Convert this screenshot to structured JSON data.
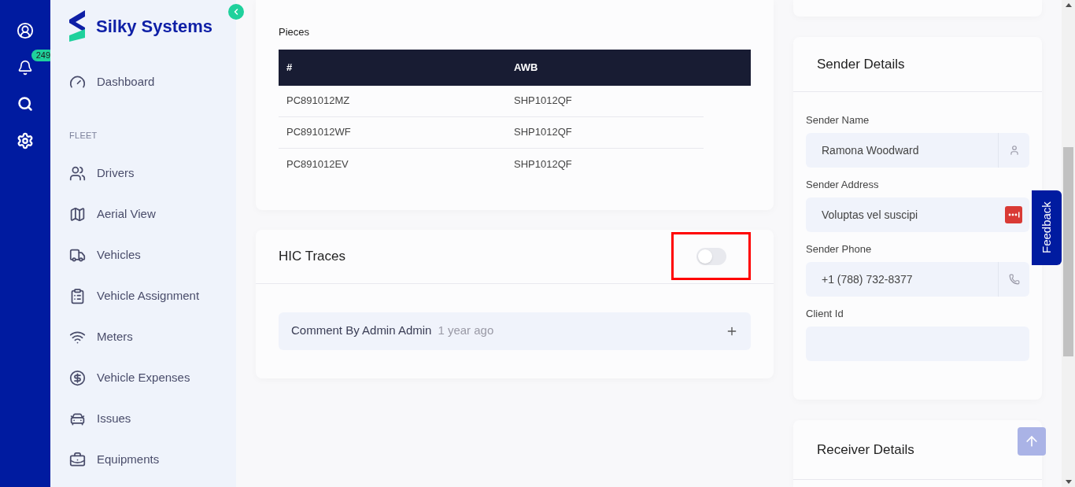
{
  "rail": {
    "notification_count": "249"
  },
  "brand": {
    "name": "Silky Systems"
  },
  "sidebar": {
    "items": [
      {
        "kind": "link",
        "label": "Dashboard"
      },
      {
        "kind": "section",
        "label": "FLEET"
      },
      {
        "kind": "link",
        "label": "Drivers"
      },
      {
        "kind": "link",
        "label": "Aerial View"
      },
      {
        "kind": "link",
        "label": "Vehicles"
      },
      {
        "kind": "link",
        "label": "Vehicle Assignment"
      },
      {
        "kind": "link",
        "label": "Meters"
      },
      {
        "kind": "link",
        "label": "Vehicle Expenses"
      },
      {
        "kind": "link",
        "label": "Issues"
      },
      {
        "kind": "link",
        "label": "Equipments"
      }
    ]
  },
  "pieces": {
    "title": "Pieces",
    "columns": [
      "#",
      "AWB"
    ],
    "rows": [
      [
        "PC891012MZ",
        "SHP1012QF"
      ],
      [
        "PC891012WF",
        "SHP1012QF"
      ],
      [
        "PC891012EV",
        "SHP1012QF"
      ]
    ]
  },
  "hic_traces": {
    "title": "HIC Traces",
    "on": false,
    "highlighted": true,
    "comment": {
      "author": "Comment By Admin Admin",
      "time": "1 year ago"
    }
  },
  "sender": {
    "title": "Sender Details",
    "fields": [
      {
        "label": "Sender Name",
        "value": "Ramona Woodward"
      },
      {
        "label": "Sender Address",
        "value": "Voluptas vel suscipi"
      },
      {
        "label": "Sender Phone",
        "value": "+1 (788) 732-8377"
      },
      {
        "label": "Client Id"
      }
    ]
  },
  "receiver": {
    "title": "Receiver Details"
  },
  "feedback": "Feedback"
}
